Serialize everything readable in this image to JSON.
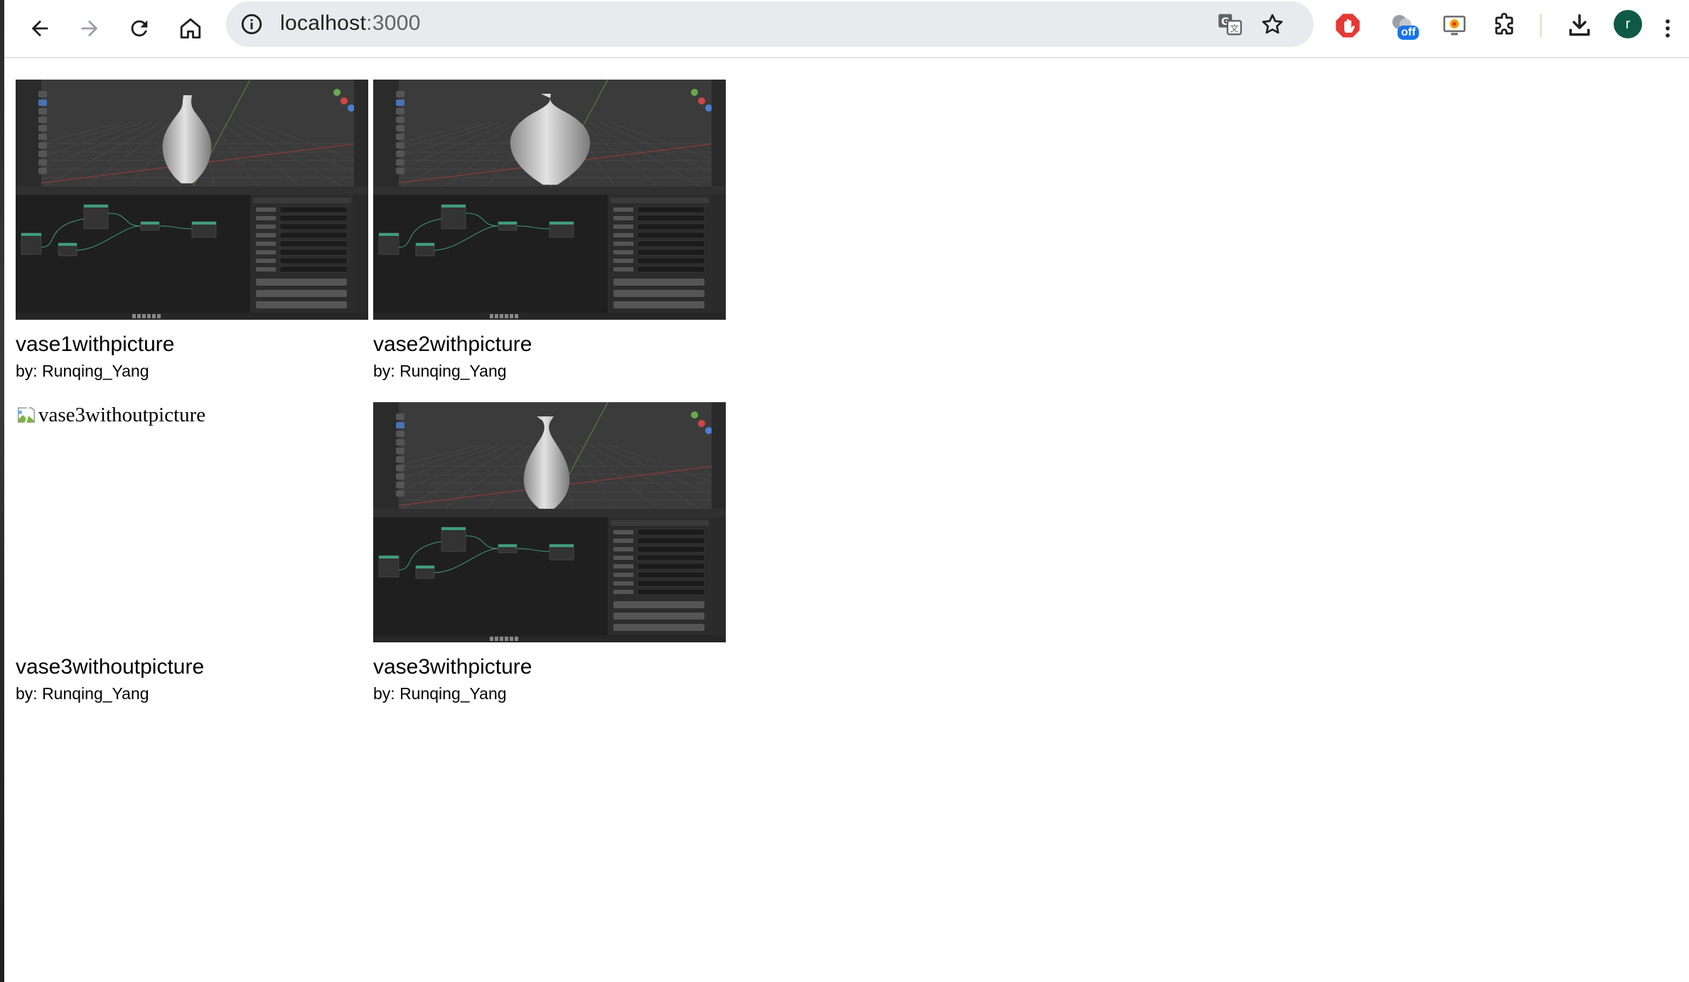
{
  "browser": {
    "url_host": "localhost",
    "url_port": ":3000",
    "extension_badge": "off",
    "profile_initial": "r",
    "icons": [
      "back-arrow-icon",
      "forward-arrow-icon",
      "reload-icon",
      "home-icon",
      "site-info-icon",
      "translate-icon",
      "bookmark-star-icon",
      "adblock-icon",
      "weather-extension-icon",
      "screen-capture-icon",
      "extensions-puzzle-icon",
      "download-icon"
    ]
  },
  "cards": [
    {
      "title": "vase1withpicture",
      "author": "by: Runqing_Yang",
      "has_image": true,
      "image_alt": "vase1withpicture"
    },
    {
      "title": "vase2withpicture",
      "author": "by: Runqing_Yang",
      "has_image": true,
      "image_alt": "vase2withpicture"
    },
    {
      "title": "vase3withoutpicture",
      "author": "by: Runqing_Yang",
      "has_image": false,
      "image_alt": "vase3withoutpicture"
    },
    {
      "title": "vase3withpicture",
      "author": "by: Runqing_Yang",
      "has_image": true,
      "image_alt": "vase3withpicture"
    }
  ],
  "colors": {
    "toolbar_bg": "#ffffff",
    "omnibox_bg": "#e9eaed",
    "avatar_bg": "#0f5a45",
    "thumb_bg": "#1d1d1d",
    "node_green": "#3f9c7c"
  }
}
